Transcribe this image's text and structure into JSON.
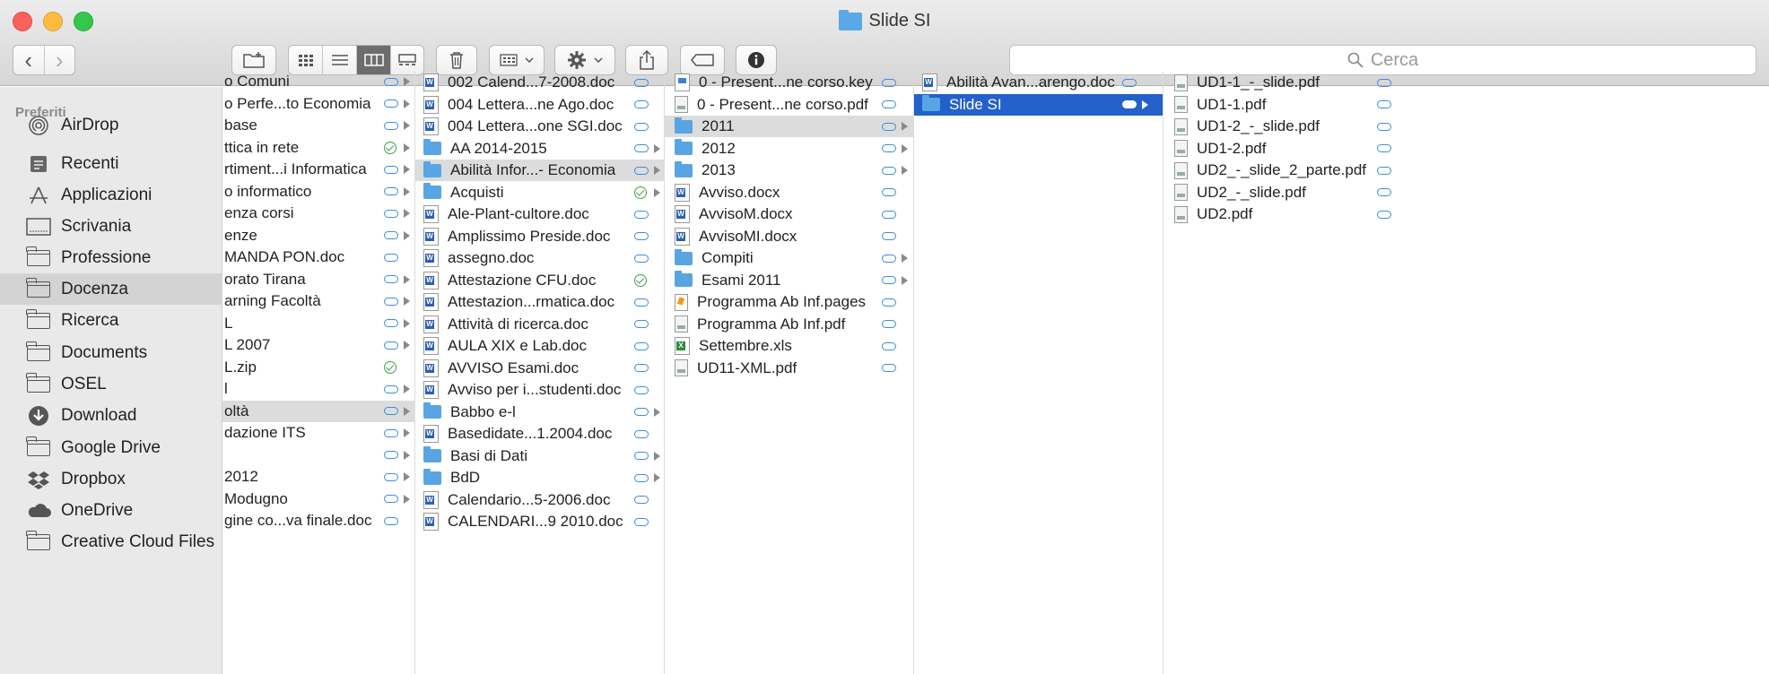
{
  "window": {
    "title": "Slide SI"
  },
  "toolbar": {
    "back": "‹",
    "forward": "›",
    "new_folder_icon": "new-folder-icon",
    "view_modes": [
      "icon-view-icon",
      "list-view-icon",
      "column-view-icon",
      "gallery-view-icon"
    ],
    "active_view": "column-view-icon",
    "trash_icon": "trash-icon",
    "group_icon": "group-icon",
    "action_icon": "gear-icon",
    "share_icon": "share-icon",
    "tag_icon": "tag-icon",
    "info_icon": "info-icon",
    "search_placeholder": "Cerca"
  },
  "sidebar": {
    "heading": "Preferiti",
    "items": [
      {
        "label": "AirDrop",
        "icon": "airdrop-icon"
      },
      {
        "label": "Recenti",
        "icon": "recents-icon"
      },
      {
        "label": "Applicazioni",
        "icon": "applications-icon"
      },
      {
        "label": "Scrivania",
        "icon": "desktop-icon"
      },
      {
        "label": "Professione",
        "icon": "folder-icon"
      },
      {
        "label": "Docenza",
        "icon": "folder-icon",
        "selected": true
      },
      {
        "label": "Ricerca",
        "icon": "folder-icon"
      },
      {
        "label": "Documents",
        "icon": "folder-icon"
      },
      {
        "label": "OSEL",
        "icon": "folder-icon"
      },
      {
        "label": "Download",
        "icon": "download-icon"
      },
      {
        "label": "Google Drive",
        "icon": "folder-icon"
      },
      {
        "label": "Dropbox",
        "icon": "dropbox-icon"
      },
      {
        "label": "OneDrive",
        "icon": "cloud-icon"
      },
      {
        "label": "Creative Cloud Files",
        "icon": "folder-icon"
      }
    ]
  },
  "columns": {
    "col1": [
      {
        "name": "o Comuni",
        "status": "cloud",
        "arrow": true
      },
      {
        "name": "o Perfe...to Economia",
        "status": "cloud",
        "arrow": true
      },
      {
        "name": "base",
        "status": "cloud",
        "arrow": true
      },
      {
        "name": "ttica in rete",
        "status": "check",
        "arrow": true
      },
      {
        "name": "rtiment...i Informatica",
        "status": "cloud",
        "arrow": true
      },
      {
        "name": "o informatico",
        "status": "cloud",
        "arrow": true
      },
      {
        "name": "enza corsi",
        "status": "cloud",
        "arrow": true
      },
      {
        "name": "enze",
        "status": "cloud",
        "arrow": true
      },
      {
        "name": "MANDA PON.doc",
        "status": "cloud",
        "arrow": false
      },
      {
        "name": "orato Tirana",
        "status": "cloud",
        "arrow": true
      },
      {
        "name": "arning Facoltà",
        "status": "cloud",
        "arrow": true
      },
      {
        "name": "L",
        "status": "cloud",
        "arrow": true
      },
      {
        "name": "L 2007",
        "status": "cloud",
        "arrow": true
      },
      {
        "name": "L.zip",
        "status": "check",
        "arrow": false
      },
      {
        "name": "l",
        "status": "cloud",
        "arrow": true
      },
      {
        "name": "oltà",
        "status": "cloud",
        "arrow": true,
        "highlight": true
      },
      {
        "name": "dazione ITS",
        "status": "cloud",
        "arrow": true
      },
      {
        "name": "",
        "status": "cloud",
        "arrow": true
      },
      {
        "name": "2012",
        "status": "cloud",
        "arrow": true
      },
      {
        "name": "Modugno",
        "status": "cloud",
        "arrow": true
      },
      {
        "name": "gine co...va finale.doc",
        "status": "cloud",
        "arrow": false
      }
    ],
    "col2": [
      {
        "name": "002 Calend...7-2008.doc",
        "type": "doc",
        "status": "cloud"
      },
      {
        "name": "004 Lettera...ne Ago.doc",
        "type": "doc",
        "status": "cloud"
      },
      {
        "name": "004 Lettera...one SGI.doc",
        "type": "doc",
        "status": "cloud"
      },
      {
        "name": "AA 2014-2015",
        "type": "folder",
        "status": "cloud",
        "arrow": true
      },
      {
        "name": "Abilità Infor...- Economia",
        "type": "folder",
        "status": "cloud",
        "arrow": true,
        "highlight": true
      },
      {
        "name": "Acquisti",
        "type": "folder",
        "status": "check",
        "arrow": true
      },
      {
        "name": "Ale-Plant-cultore.doc",
        "type": "doc",
        "status": "cloud"
      },
      {
        "name": "Amplissimo Preside.doc",
        "type": "doc",
        "status": "cloud"
      },
      {
        "name": "assegno.doc",
        "type": "doc",
        "status": "cloud"
      },
      {
        "name": "Attestazione CFU.doc",
        "type": "doc",
        "status": "check"
      },
      {
        "name": "Attestazion...rmatica.doc",
        "type": "doc",
        "status": "cloud"
      },
      {
        "name": "Attività di ricerca.doc",
        "type": "doc",
        "status": "cloud"
      },
      {
        "name": "AULA XIX e Lab.doc",
        "type": "doc",
        "status": "cloud"
      },
      {
        "name": "AVVISO Esami.doc",
        "type": "doc",
        "status": "cloud"
      },
      {
        "name": "Avviso per i...studenti.doc",
        "type": "doc",
        "status": "cloud"
      },
      {
        "name": "Babbo e-l",
        "type": "folder",
        "status": "cloud",
        "arrow": true
      },
      {
        "name": "Basedidate...1.2004.doc",
        "type": "doc",
        "status": "cloud"
      },
      {
        "name": "Basi di Dati",
        "type": "folder",
        "status": "cloud",
        "arrow": true
      },
      {
        "name": "BdD",
        "type": "folder",
        "status": "cloud",
        "arrow": true
      },
      {
        "name": "Calendario...5-2006.doc",
        "type": "doc",
        "status": "cloud"
      },
      {
        "name": "CALENDARI...9 2010.doc",
        "type": "doc",
        "status": "cloud"
      }
    ],
    "col3": [
      {
        "name": "0 - Present...ne corso.key",
        "type": "key",
        "status": "cloud"
      },
      {
        "name": "0 - Present...ne corso.pdf",
        "type": "pdf",
        "status": "cloud"
      },
      {
        "name": "2011",
        "type": "folder",
        "status": "cloud",
        "arrow": true,
        "highlight": true
      },
      {
        "name": "2012",
        "type": "folder",
        "status": "cloud",
        "arrow": true
      },
      {
        "name": "2013",
        "type": "folder",
        "status": "cloud",
        "arrow": true
      },
      {
        "name": "Avviso.docx",
        "type": "doc",
        "status": "cloud"
      },
      {
        "name": "AvvisoM.docx",
        "type": "doc",
        "status": "cloud"
      },
      {
        "name": "AvvisoMI.docx",
        "type": "doc",
        "status": "cloud"
      },
      {
        "name": "Compiti",
        "type": "folder",
        "status": "cloud",
        "arrow": true
      },
      {
        "name": "Esami 2011",
        "type": "folder",
        "status": "cloud",
        "arrow": true
      },
      {
        "name": "Programma Ab Inf.pages",
        "type": "pages",
        "status": "cloud"
      },
      {
        "name": "Programma Ab Inf.pdf",
        "type": "pdf",
        "status": "cloud"
      },
      {
        "name": "Settembre.xls",
        "type": "xls",
        "status": "cloud"
      },
      {
        "name": "UD11-XML.pdf",
        "type": "pdf",
        "status": "cloud"
      }
    ],
    "col4": [
      {
        "name": "Abilità Avan...arengo.doc",
        "type": "doc",
        "status": "cloud"
      },
      {
        "name": "Slide SI",
        "type": "folder",
        "status": "cloud",
        "arrow": true,
        "selected": true
      }
    ],
    "col5": [
      {
        "name": "UD1-1_-_slide.pdf",
        "type": "pdf",
        "status": "cloud"
      },
      {
        "name": "UD1-1.pdf",
        "type": "pdf",
        "status": "cloud"
      },
      {
        "name": "UD1-2_-_slide.pdf",
        "type": "pdf",
        "status": "cloud"
      },
      {
        "name": "UD1-2.pdf",
        "type": "pdf",
        "status": "cloud"
      },
      {
        "name": "UD2_-_slide_2_parte.pdf",
        "type": "pdf",
        "status": "cloud"
      },
      {
        "name": "UD2_-_slide.pdf",
        "type": "pdf",
        "status": "cloud"
      },
      {
        "name": "UD2.pdf",
        "type": "pdf",
        "status": "cloud"
      }
    ]
  },
  "colors": {
    "selection": "#2460c9",
    "folder": "#59a5e3",
    "cloud": "#3a8ce0",
    "check": "#38a348"
  }
}
